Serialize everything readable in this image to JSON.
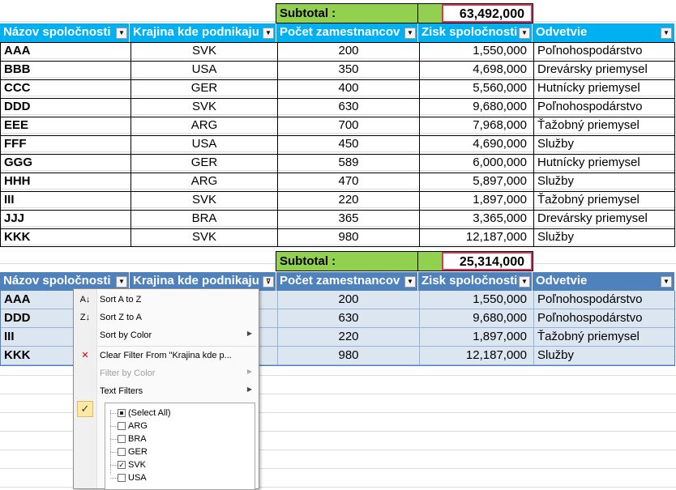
{
  "table1": {
    "subtotal_label": "Subtotal :",
    "subtotal_value": "63,492,000",
    "headers": [
      "Názov spoločnosti",
      "Krajina kde podnikaju",
      "Počet zamestnancov",
      "Zisk spoločnosti",
      "Odvetvie"
    ],
    "rows": [
      {
        "name": "AAA",
        "country": "SVK",
        "employees": "200",
        "profit": "1,550,000",
        "sector": "Poľnohospodárstvo"
      },
      {
        "name": "BBB",
        "country": "USA",
        "employees": "350",
        "profit": "4,698,000",
        "sector": "Drevársky priemysel"
      },
      {
        "name": "CCC",
        "country": "GER",
        "employees": "400",
        "profit": "5,560,000",
        "sector": "Hutnícky priemysel"
      },
      {
        "name": "DDD",
        "country": "SVK",
        "employees": "630",
        "profit": "9,680,000",
        "sector": "Poľnohospodárstvo"
      },
      {
        "name": "EEE",
        "country": "ARG",
        "employees": "700",
        "profit": "7,968,000",
        "sector": "Ťažobný priemysel"
      },
      {
        "name": "FFF",
        "country": "USA",
        "employees": "450",
        "profit": "4,690,000",
        "sector": "Služby"
      },
      {
        "name": "GGG",
        "country": "GER",
        "employees": "589",
        "profit": "6,000,000",
        "sector": "Hutnícky priemysel"
      },
      {
        "name": "HHH",
        "country": "ARG",
        "employees": "470",
        "profit": "5,897,000",
        "sector": "Služby"
      },
      {
        "name": "III",
        "country": "SVK",
        "employees": "220",
        "profit": "1,897,000",
        "sector": "Ťažobný priemysel"
      },
      {
        "name": "JJJ",
        "country": "BRA",
        "employees": "365",
        "profit": "3,365,000",
        "sector": "Drevársky priemysel"
      },
      {
        "name": "KKK",
        "country": "SVK",
        "employees": "980",
        "profit": "12,187,000",
        "sector": "Služby"
      }
    ]
  },
  "table2": {
    "subtotal_label": "Subtotal :",
    "subtotal_value": "25,314,000",
    "headers": [
      "Názov spoločnosti",
      "Krajina kde podnikaju",
      "Počet zamestnancov",
      "Zisk spoločnosti",
      "Odvetvie"
    ],
    "rows": [
      {
        "name": "AAA",
        "employees": "200",
        "profit": "1,550,000",
        "sector": "Poľnohospodárstvo"
      },
      {
        "name": "DDD",
        "employees": "630",
        "profit": "9,680,000",
        "sector": "Poľnohospodárstvo"
      },
      {
        "name": "III",
        "employees": "220",
        "profit": "1,897,000",
        "sector": "Ťažobný priemysel"
      },
      {
        "name": "KKK",
        "employees": "980",
        "profit": "12,187,000",
        "sector": "Služby"
      }
    ]
  },
  "filter_menu": {
    "items": {
      "sort_az": "Sort A to Z",
      "sort_za": "Sort Z to A",
      "sort_color": "Sort by Color",
      "clear_filter": "Clear Filter From \"Krajina kde p...",
      "filter_color": "Filter by Color",
      "text_filters": "Text Filters"
    },
    "checklist": [
      {
        "label": "(Select All)",
        "state": "partial"
      },
      {
        "label": "ARG",
        "state": "unchecked"
      },
      {
        "label": "BRA",
        "state": "unchecked"
      },
      {
        "label": "GER",
        "state": "unchecked"
      },
      {
        "label": "SVK",
        "state": "checked"
      },
      {
        "label": "USA",
        "state": "unchecked"
      }
    ],
    "check_glyph": "✓"
  },
  "colors": {
    "header_cyan": "#00b0f0",
    "header_blue": "#4f81bd",
    "subtotal_green": "#92d050",
    "highlight_red": "#e0315a",
    "row_tint": "#dce6f1"
  }
}
